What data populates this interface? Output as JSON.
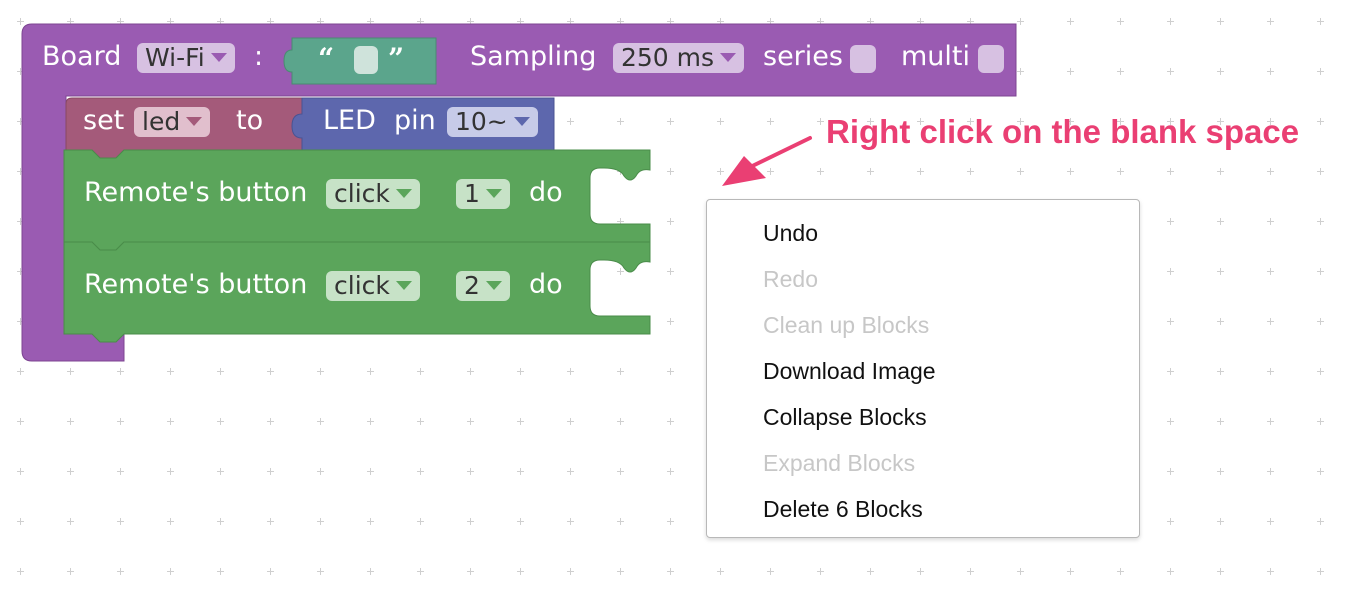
{
  "board_block": {
    "label": "Board",
    "dropdown": "Wi-Fi",
    "colon": ":",
    "quote_open": "“",
    "quote_close": "”",
    "sampling_label": "Sampling",
    "sampling_value": "250 ms",
    "series_label": "series",
    "multi_label": "multi",
    "color": "#9a5bb2"
  },
  "set_block": {
    "set_label": "set",
    "variable": "led",
    "to_label": "to",
    "color": "#a45a7a"
  },
  "led_block": {
    "label": "LED",
    "pin_label": "pin",
    "pin_value": "10~",
    "color": "#5d67ad"
  },
  "remote_blocks": [
    {
      "label": "Remote's button",
      "event": "click",
      "button": "1",
      "do_label": "do"
    },
    {
      "label": "Remote's button",
      "event": "click",
      "button": "2",
      "do_label": "do"
    }
  ],
  "remote_color": "#5ba55b",
  "context_menu": {
    "items": [
      {
        "label": "Undo",
        "enabled": true
      },
      {
        "label": "Redo",
        "enabled": false
      },
      {
        "label": "Clean up Blocks",
        "enabled": false
      },
      {
        "label": "Download Image",
        "enabled": true
      },
      {
        "label": "Collapse Blocks",
        "enabled": true
      },
      {
        "label": "Expand Blocks",
        "enabled": false
      },
      {
        "label": "Delete 6 Blocks",
        "enabled": true
      }
    ]
  },
  "annotation": {
    "text": "Right click on the blank space",
    "color": "#ea3f73"
  }
}
